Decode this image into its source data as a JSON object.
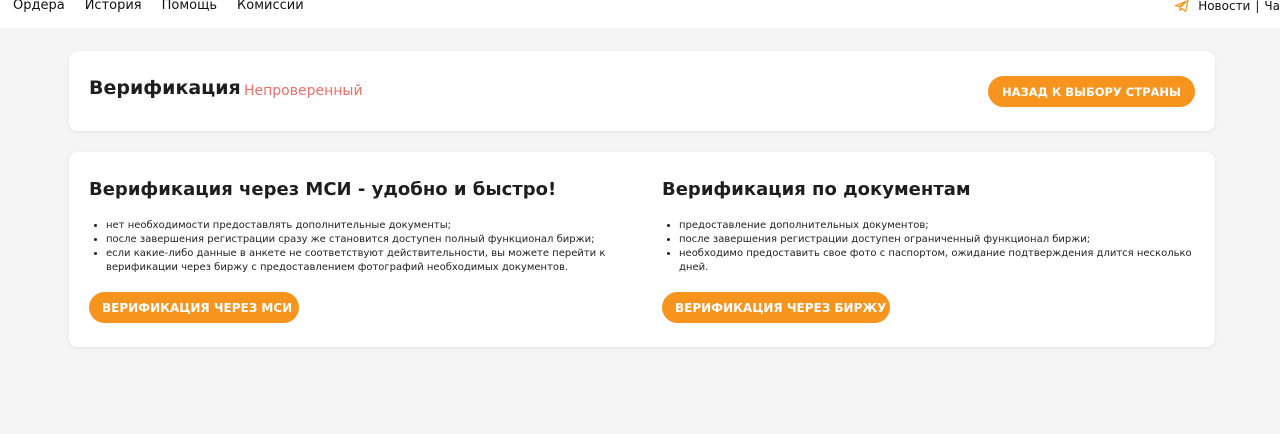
{
  "nav": {
    "items": [
      "Ордера",
      "История",
      "Помощь",
      "Комиссии"
    ],
    "right_news": "Новости",
    "right_sep": "|",
    "right_chat": "Ча"
  },
  "colors": {
    "accent": "#f7941d",
    "status": "#e8706a",
    "background": "#f5f5f5"
  },
  "header": {
    "title": "Верификация",
    "status": "Непроверенный",
    "back_button": "НАЗАД К ВЫБОРУ СТРАНЫ"
  },
  "msi": {
    "title": "Верификация через МСИ - удобно и быстро!",
    "bullets": [
      "нет необходимости предоставлять дополнительные документы;",
      "после завершения регистрации сразу же становится доступен полный функционал биржи;",
      "если какие-либо данные в анкете не соответствуют действительности, вы можете перейти к верификации через биржу с предоставлением фотографий необходимых документов."
    ],
    "button": "ВЕРИФИКАЦИЯ ЧЕРЕЗ МСИ"
  },
  "docs": {
    "title": "Верификация по документам",
    "bullets": [
      "предоставление дополнительных документов;",
      "после завершения регистрации доступен ограниченный функционал биржи;",
      "необходимо предоставить свое фото с паспортом, ожидание подтверждения длится несколько дней."
    ],
    "button": "ВЕРИФИКАЦИЯ ЧЕРЕЗ БИРЖУ"
  },
  "icons": {
    "telegram": "telegram-icon"
  }
}
